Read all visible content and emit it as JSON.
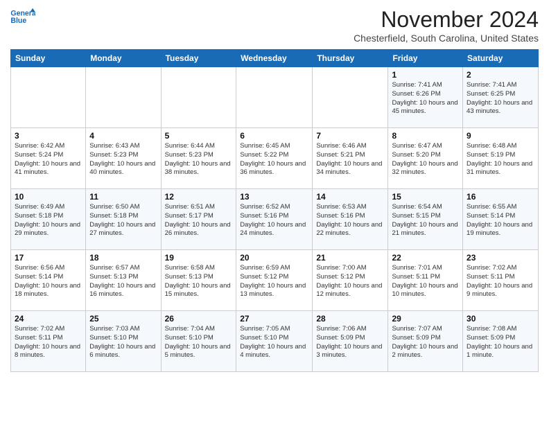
{
  "header": {
    "logo_line1": "General",
    "logo_line2": "Blue",
    "month": "November 2024",
    "location": "Chesterfield, South Carolina, United States"
  },
  "days_of_week": [
    "Sunday",
    "Monday",
    "Tuesday",
    "Wednesday",
    "Thursday",
    "Friday",
    "Saturday"
  ],
  "weeks": [
    [
      {
        "day": "",
        "content": ""
      },
      {
        "day": "",
        "content": ""
      },
      {
        "day": "",
        "content": ""
      },
      {
        "day": "",
        "content": ""
      },
      {
        "day": "",
        "content": ""
      },
      {
        "day": "1",
        "content": "Sunrise: 7:41 AM\nSunset: 6:26 PM\nDaylight: 10 hours and 45 minutes."
      },
      {
        "day": "2",
        "content": "Sunrise: 7:41 AM\nSunset: 6:25 PM\nDaylight: 10 hours and 43 minutes."
      }
    ],
    [
      {
        "day": "3",
        "content": "Sunrise: 6:42 AM\nSunset: 5:24 PM\nDaylight: 10 hours and 41 minutes."
      },
      {
        "day": "4",
        "content": "Sunrise: 6:43 AM\nSunset: 5:23 PM\nDaylight: 10 hours and 40 minutes."
      },
      {
        "day": "5",
        "content": "Sunrise: 6:44 AM\nSunset: 5:23 PM\nDaylight: 10 hours and 38 minutes."
      },
      {
        "day": "6",
        "content": "Sunrise: 6:45 AM\nSunset: 5:22 PM\nDaylight: 10 hours and 36 minutes."
      },
      {
        "day": "7",
        "content": "Sunrise: 6:46 AM\nSunset: 5:21 PM\nDaylight: 10 hours and 34 minutes."
      },
      {
        "day": "8",
        "content": "Sunrise: 6:47 AM\nSunset: 5:20 PM\nDaylight: 10 hours and 32 minutes."
      },
      {
        "day": "9",
        "content": "Sunrise: 6:48 AM\nSunset: 5:19 PM\nDaylight: 10 hours and 31 minutes."
      }
    ],
    [
      {
        "day": "10",
        "content": "Sunrise: 6:49 AM\nSunset: 5:18 PM\nDaylight: 10 hours and 29 minutes."
      },
      {
        "day": "11",
        "content": "Sunrise: 6:50 AM\nSunset: 5:18 PM\nDaylight: 10 hours and 27 minutes."
      },
      {
        "day": "12",
        "content": "Sunrise: 6:51 AM\nSunset: 5:17 PM\nDaylight: 10 hours and 26 minutes."
      },
      {
        "day": "13",
        "content": "Sunrise: 6:52 AM\nSunset: 5:16 PM\nDaylight: 10 hours and 24 minutes."
      },
      {
        "day": "14",
        "content": "Sunrise: 6:53 AM\nSunset: 5:16 PM\nDaylight: 10 hours and 22 minutes."
      },
      {
        "day": "15",
        "content": "Sunrise: 6:54 AM\nSunset: 5:15 PM\nDaylight: 10 hours and 21 minutes."
      },
      {
        "day": "16",
        "content": "Sunrise: 6:55 AM\nSunset: 5:14 PM\nDaylight: 10 hours and 19 minutes."
      }
    ],
    [
      {
        "day": "17",
        "content": "Sunrise: 6:56 AM\nSunset: 5:14 PM\nDaylight: 10 hours and 18 minutes."
      },
      {
        "day": "18",
        "content": "Sunrise: 6:57 AM\nSunset: 5:13 PM\nDaylight: 10 hours and 16 minutes."
      },
      {
        "day": "19",
        "content": "Sunrise: 6:58 AM\nSunset: 5:13 PM\nDaylight: 10 hours and 15 minutes."
      },
      {
        "day": "20",
        "content": "Sunrise: 6:59 AM\nSunset: 5:12 PM\nDaylight: 10 hours and 13 minutes."
      },
      {
        "day": "21",
        "content": "Sunrise: 7:00 AM\nSunset: 5:12 PM\nDaylight: 10 hours and 12 minutes."
      },
      {
        "day": "22",
        "content": "Sunrise: 7:01 AM\nSunset: 5:11 PM\nDaylight: 10 hours and 10 minutes."
      },
      {
        "day": "23",
        "content": "Sunrise: 7:02 AM\nSunset: 5:11 PM\nDaylight: 10 hours and 9 minutes."
      }
    ],
    [
      {
        "day": "24",
        "content": "Sunrise: 7:02 AM\nSunset: 5:11 PM\nDaylight: 10 hours and 8 minutes."
      },
      {
        "day": "25",
        "content": "Sunrise: 7:03 AM\nSunset: 5:10 PM\nDaylight: 10 hours and 6 minutes."
      },
      {
        "day": "26",
        "content": "Sunrise: 7:04 AM\nSunset: 5:10 PM\nDaylight: 10 hours and 5 minutes."
      },
      {
        "day": "27",
        "content": "Sunrise: 7:05 AM\nSunset: 5:10 PM\nDaylight: 10 hours and 4 minutes."
      },
      {
        "day": "28",
        "content": "Sunrise: 7:06 AM\nSunset: 5:09 PM\nDaylight: 10 hours and 3 minutes."
      },
      {
        "day": "29",
        "content": "Sunrise: 7:07 AM\nSunset: 5:09 PM\nDaylight: 10 hours and 2 minutes."
      },
      {
        "day": "30",
        "content": "Sunrise: 7:08 AM\nSunset: 5:09 PM\nDaylight: 10 hours and 1 minute."
      }
    ]
  ]
}
